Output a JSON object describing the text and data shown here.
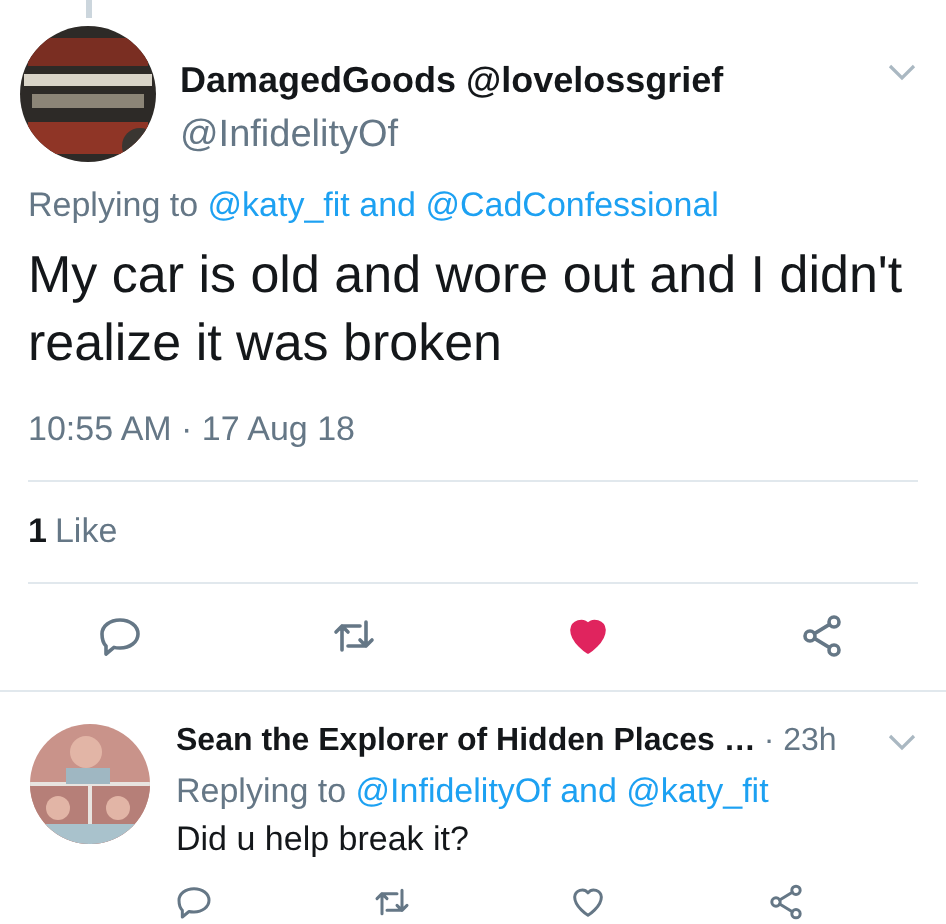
{
  "tweet": {
    "name": "DamagedGoods @lovelossgrief",
    "handle": "@InfidelityOf",
    "replying_prefix": "Replying to",
    "replying_to": "@katy_fit and @CadConfessional",
    "text": "My car is old and wore out and I didn't realize it was broken",
    "timestamp": "10:55 AM · 17 Aug 18",
    "like_count": "1",
    "like_label": "Like",
    "liked": true
  },
  "reply": {
    "name": "Sean the Explorer of Hidden Places …",
    "time": "· 23h",
    "replying_prefix": "Replying to",
    "replying_to": "@InfidelityOf and @katy_fit",
    "text": "Did u help break it?",
    "liked": false
  }
}
